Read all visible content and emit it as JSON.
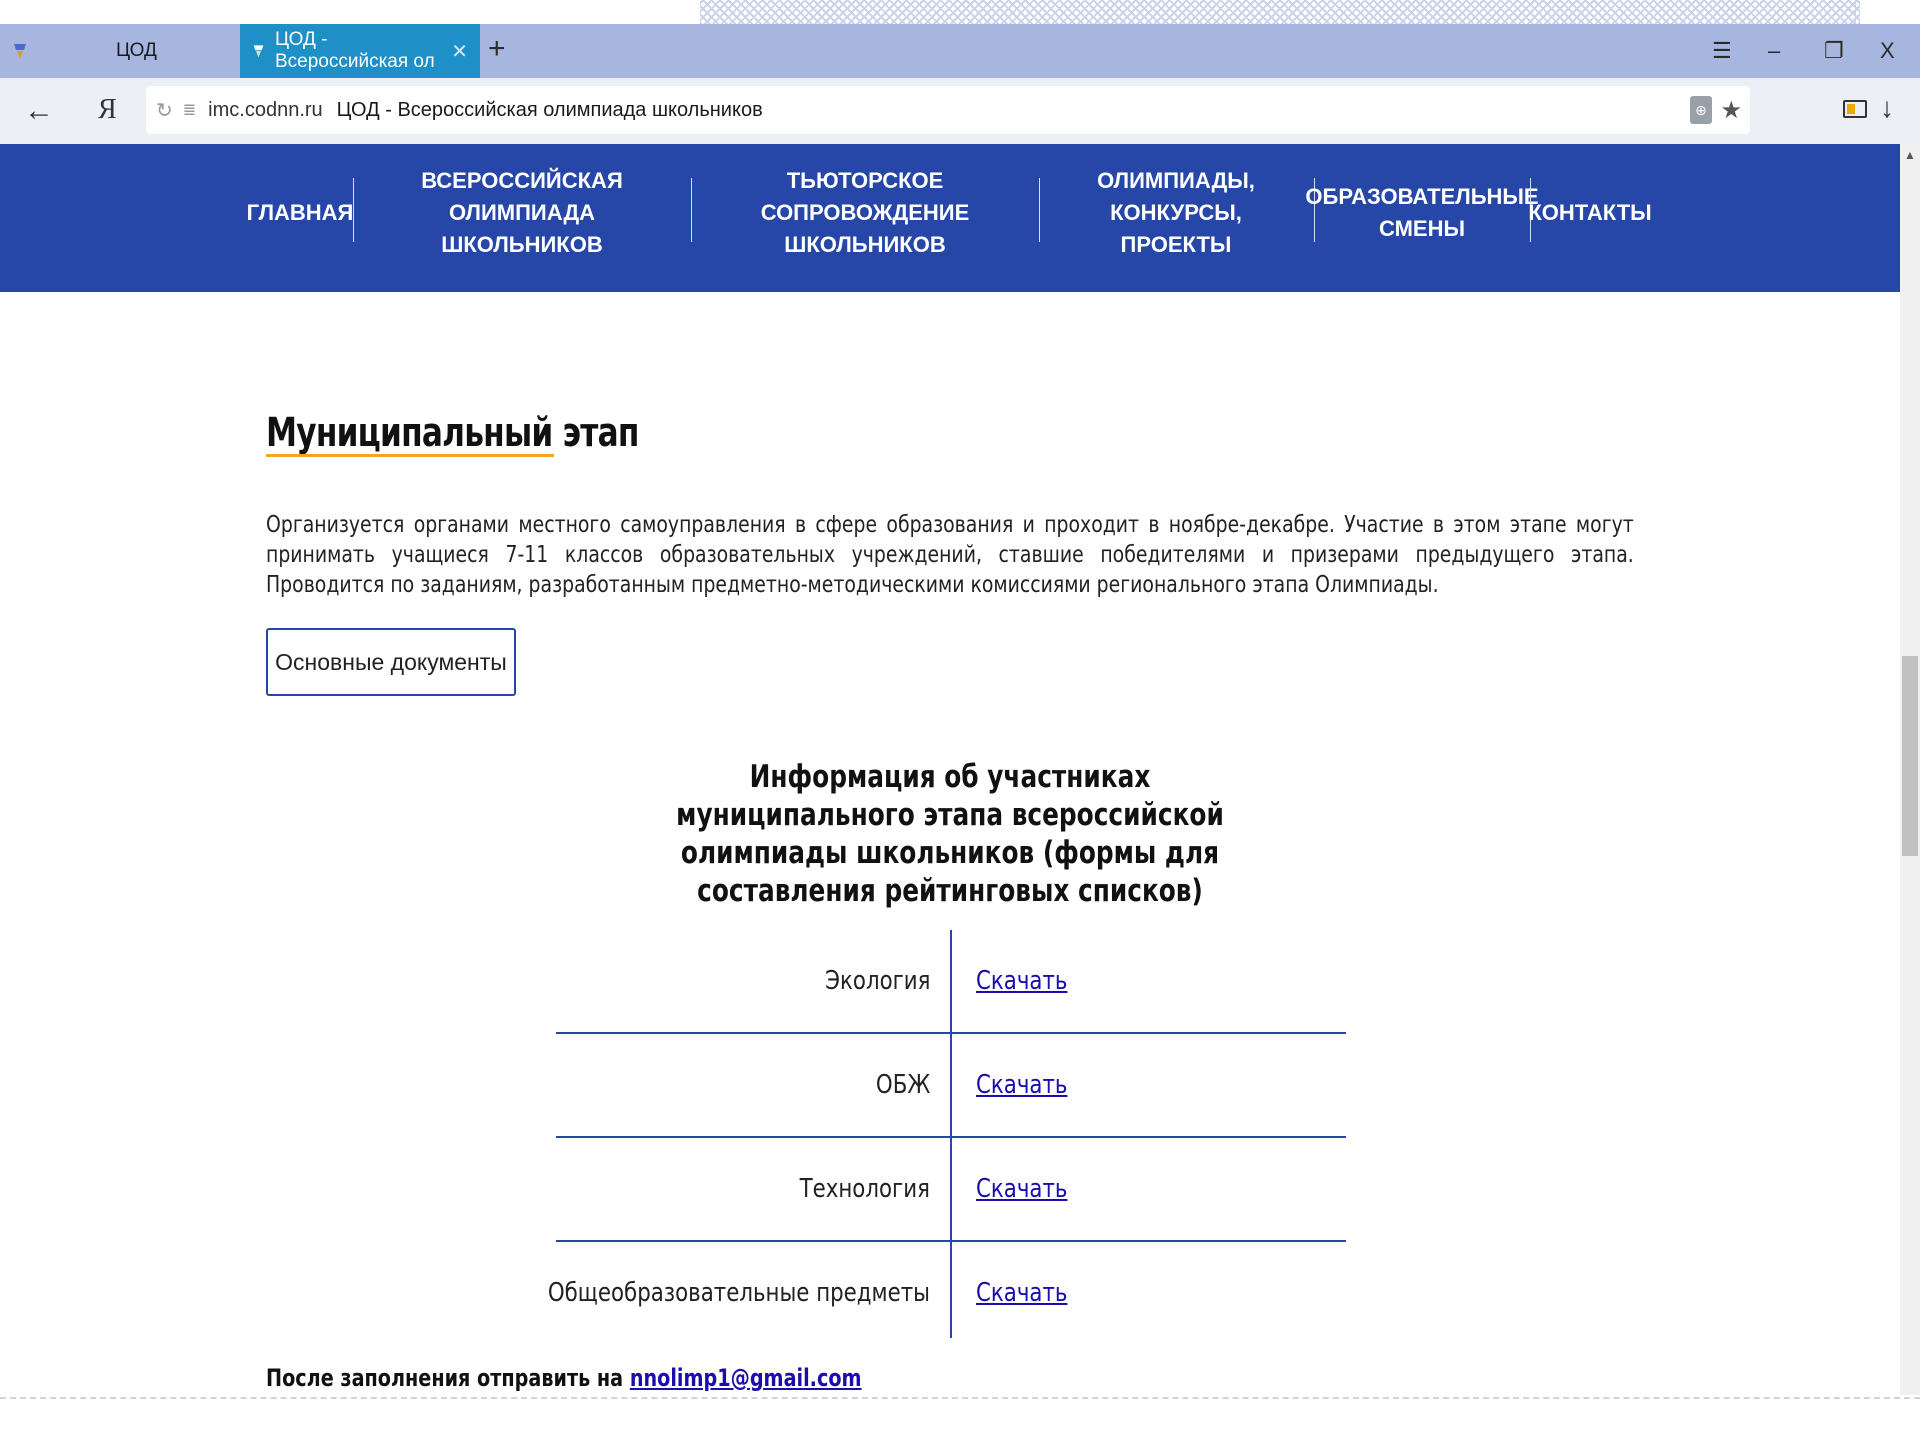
{
  "browser": {
    "tabs": [
      {
        "label": "ЦОД",
        "active": false
      },
      {
        "label": "ЦОД - Всероссийская ол",
        "active": true
      }
    ],
    "new_tab": "+",
    "window_controls": {
      "menu": "☰",
      "minimize": "–",
      "restore": "❐",
      "close": "X"
    },
    "back": "←",
    "yandex_button": "Я",
    "address": {
      "domain": "imc.codnn.ru",
      "page_title": "ЦОД - Всероссийская олимпиада школьников"
    },
    "download": "↓"
  },
  "nav": {
    "items": [
      "ГЛАВНАЯ",
      "ВСЕРОССИЙСКАЯ ОЛИМПИАДА ШКОЛЬНИКОВ",
      "ТЬЮТОРСКОЕ СОПРОВОЖДЕНИЕ ШКОЛЬНИКОВ",
      "ОЛИМПИАДЫ, КОНКУРСЫ, ПРОЕКТЫ",
      "ОБРАЗОВАТЕЛЬНЫЕ СМЕНЫ",
      "КОНТАКТЫ"
    ]
  },
  "page": {
    "heading": "Муниципальный этап",
    "intro": "Организуется органами местного самоуправления в сфере образования и проходит в ноябре-декабре. Участие в этом этапе могут принимать учащиеся 7-11 классов образовательных учреждений, ставшие победителями и призерами предыдущего этапа. Проводится по заданиям, разработанным предметно-методическими комиссиями регионального этапа Олимпиады.",
    "docs_button": "Основные документы",
    "table_title": "Информация об участниках муниципального этапа всероссийской олимпиады школьников (формы для составления рейтинговых списков)",
    "table": [
      {
        "subject": "Экология",
        "link": "Скачать"
      },
      {
        "subject": "ОБЖ",
        "link": "Скачать"
      },
      {
        "subject": "Технология",
        "link": "Скачать"
      },
      {
        "subject": "Общеобразовательные предметы",
        "link": "Скачать"
      }
    ],
    "send_note": "После заполнения отправить на",
    "email": "nnolimp1@gmail.com"
  },
  "colors": {
    "nav_bg": "#2647a7",
    "accent_underline": "#f0a61f",
    "active_tab": "#1e8fc7",
    "link": "#1a0dab"
  }
}
